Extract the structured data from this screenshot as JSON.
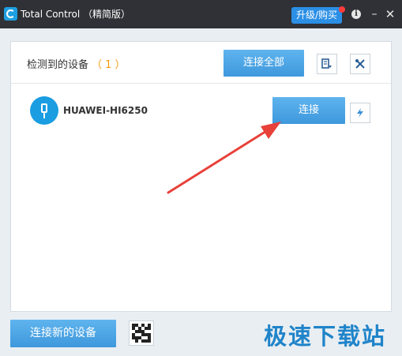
{
  "titlebar": {
    "title": "Total Control （精简版）",
    "upgrade_label": "升级/购买",
    "info_icon": "i",
    "minimize_icon": "–",
    "close_icon": "✕"
  },
  "header": {
    "detected_label": "检测到的设备",
    "detected_count": "（ 1 ）",
    "connect_all_label": "连接全部",
    "export_icon": "export-icon",
    "tools_icon": "tools-icon"
  },
  "devices": [
    {
      "name": "HUAWEI-HI6250",
      "connect_label": "连接",
      "icon": "usb-icon"
    }
  ],
  "footer": {
    "connect_new_label": "连接新的设备",
    "qr_icon": "qr-code-icon",
    "watermark": "极速下载站"
  },
  "colors": {
    "accent": "#4aa6e6",
    "titlebar": "#2f3136",
    "count": "#f39c12",
    "arrow": "#e8413a"
  }
}
